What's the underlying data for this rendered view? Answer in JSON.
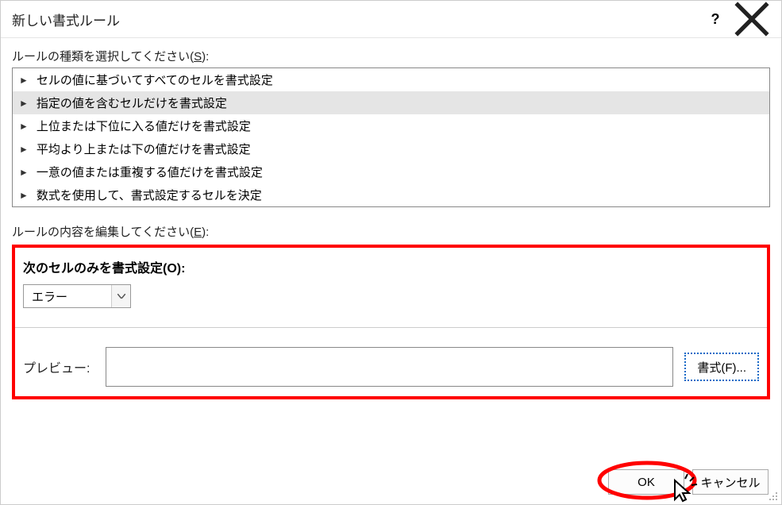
{
  "titlebar": {
    "title": "新しい書式ルール",
    "help": "?"
  },
  "ruleTypeLabel": {
    "prefix": "ルールの種類を選択してください(",
    "key": "S",
    "suffix": "):"
  },
  "ruleTypes": [
    "セルの値に基づいてすべてのセルを書式設定",
    "指定の値を含むセルだけを書式設定",
    "上位または下位に入る値だけを書式設定",
    "平均より上または下の値だけを書式設定",
    "一意の値または重複する値だけを書式設定",
    "数式を使用して、書式設定するセルを決定"
  ],
  "editLabel": {
    "prefix": "ルールの内容を編集してください(",
    "key": "E",
    "suffix": "):"
  },
  "formatOnly": {
    "prefix": "次のセルのみを書式設定(",
    "key": "O",
    "suffix": "):"
  },
  "dropdown": {
    "value": "エラー"
  },
  "preview": {
    "label": "プレビュー:"
  },
  "formatBtn": {
    "prefix": "書式(",
    "key": "F",
    "suffix": ")..."
  },
  "buttons": {
    "ok": "OK",
    "cancel": "キャンセル"
  }
}
